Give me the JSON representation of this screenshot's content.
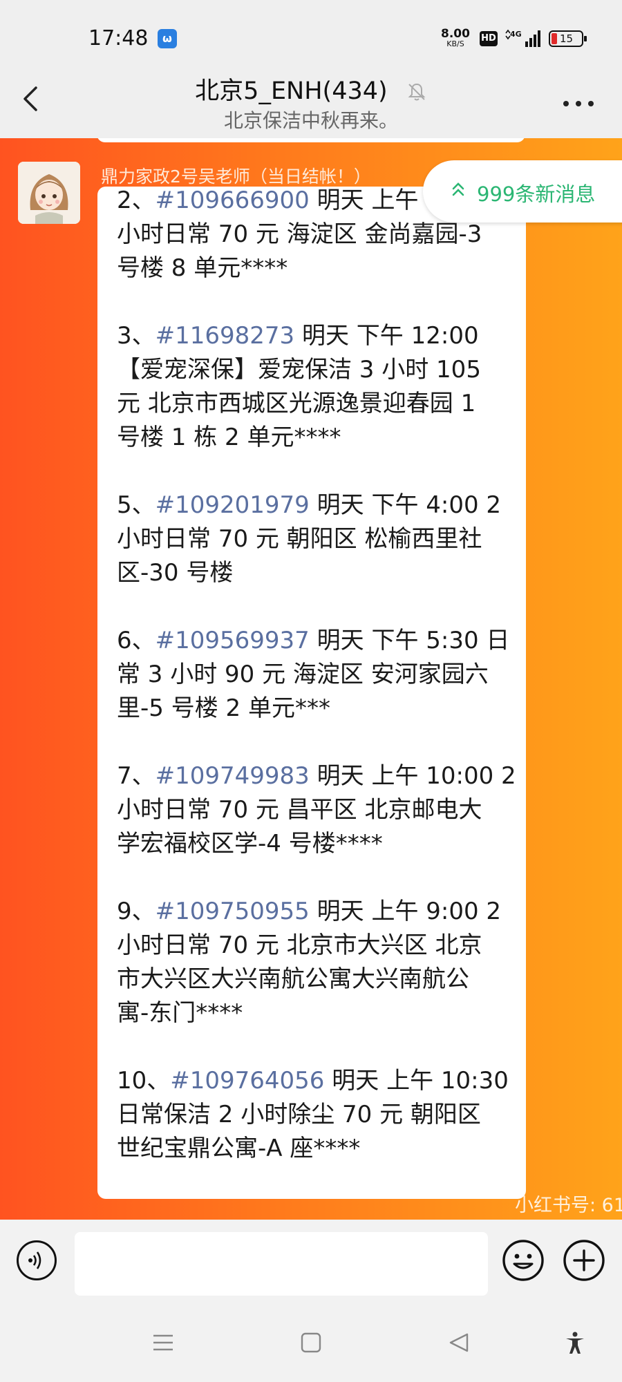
{
  "status_bar": {
    "time": "17:48",
    "app_badge": "ω",
    "net_speed_value": "8.00",
    "net_speed_unit": "KB/S",
    "hd": "HD",
    "network": "4G",
    "battery": "15"
  },
  "header": {
    "title": "北京5_ENH(434)",
    "subtitle": "北京保洁中秋再来。"
  },
  "message": {
    "sender": "鼎力家政2号吴老师（当日结帐！）",
    "lines": [
      {
        "text": "2、",
        "num": "#109666900",
        "rest": " 明天 上午 11:30 2"
      },
      {
        "text": "小时日常 70 元 海淀区 金尚嘉园-3"
      },
      {
        "text": "号楼 8 单元****"
      },
      {
        "text": "3、",
        "num": "#11698273",
        "rest": " 明天 下午 12:00"
      },
      {
        "text": "【爱宠深保】爱宠保洁 3 小时 105"
      },
      {
        "text": "元 北京市西城区光源逸景迎春园 1"
      },
      {
        "text": "号楼 1 栋 2 单元****"
      },
      {
        "text": "5、",
        "num": "#109201979",
        "rest": " 明天 下午 4:00 2"
      },
      {
        "text": "小时日常 70 元 朝阳区 松榆西里社"
      },
      {
        "text": "区-30 号楼"
      },
      {
        "text": "6、",
        "num": "#109569937",
        "rest": " 明天 下午 5:30 日"
      },
      {
        "text": "常 3 小时 90 元 海淀区 安河家园六"
      },
      {
        "text": "里-5 号楼 2 单元***"
      },
      {
        "text": "7、",
        "num": "#109749983",
        "rest": " 明天 上午 10:00 2"
      },
      {
        "text": "小时日常 70 元 昌平区 北京邮电大"
      },
      {
        "text": "学宏福校区学-4 号楼****"
      },
      {
        "text": "9、",
        "num": "#109750955",
        "rest": " 明天 上午 9:00 2"
      },
      {
        "text": "小时日常 70 元 北京市大兴区 北京"
      },
      {
        "text": "市大兴区大兴南航公寓大兴南航公"
      },
      {
        "text": "寓-东门****"
      },
      {
        "text": "10、",
        "num": "#109764056",
        "rest": " 明天 上午 10:30"
      },
      {
        "text": "日常保洁 2 小时除尘  70 元 朝阳区"
      },
      {
        "text": "世纪宝鼎公寓-A 座****"
      }
    ]
  },
  "new_messages": "999条新消息",
  "watermark": "小红书号: 61",
  "input": {
    "placeholder": ""
  },
  "icons": [
    "back-icon",
    "mute-icon",
    "more-icon",
    "voice-icon",
    "emoji-icon",
    "plus-icon",
    "menu-icon",
    "home-icon",
    "back-triangle-icon",
    "accessibility-icon"
  ]
}
